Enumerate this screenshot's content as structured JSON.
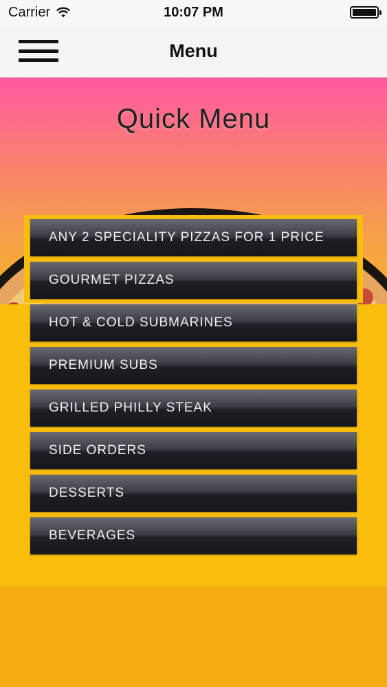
{
  "status_bar": {
    "carrier": "Carrier",
    "time": "10:07 PM"
  },
  "nav": {
    "title": "Menu"
  },
  "hero": {
    "title": "Quick Menu"
  },
  "menu": {
    "items": [
      {
        "label": "ANY 2 SPECIALITY PIZZAS FOR 1 PRICE"
      },
      {
        "label": "GOURMET PIZZAS"
      },
      {
        "label": "HOT & COLD SUBMARINES"
      },
      {
        "label": "PREMIUM SUBS"
      },
      {
        "label": "GRILLED PHILLY STEAK"
      },
      {
        "label": "SIDE ORDERS"
      },
      {
        "label": "DESSERTS"
      },
      {
        "label": "BEVERAGES"
      }
    ]
  },
  "colors": {
    "background": "#f8bd0d",
    "button_dark": "#17161c",
    "hero_top": "#ff5aa0"
  }
}
